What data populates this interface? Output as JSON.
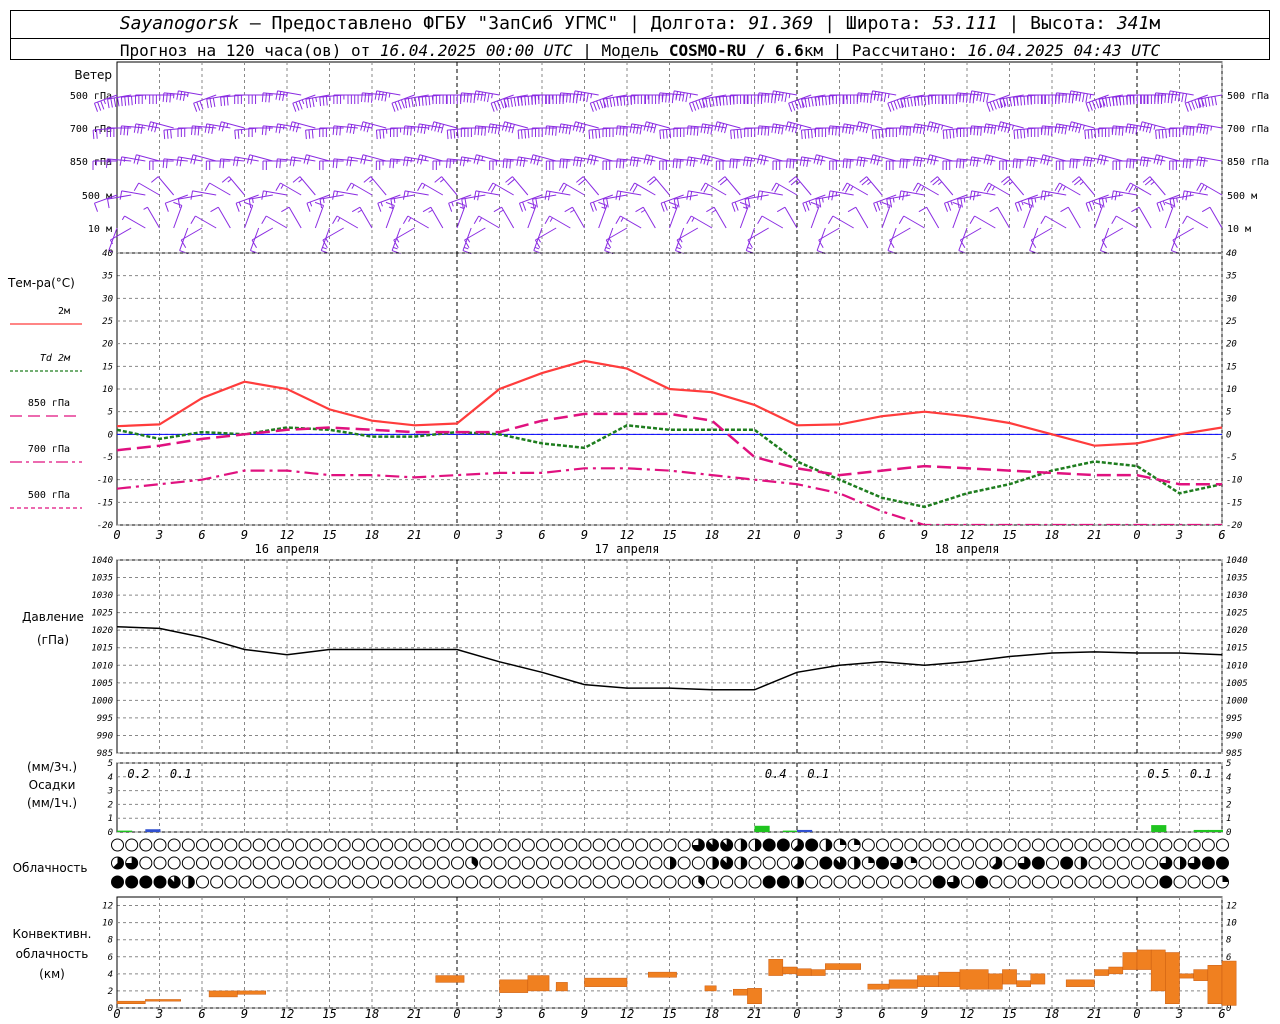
{
  "header": {
    "station": "Sayanogorsk",
    "provider": " — Предоставлено ФГБУ \"ЗапСиб УГМС\" | Долгота: ",
    "lon": "91.369",
    "lat_label": " | Широта: ",
    "lat": "53.111",
    "alt_label": " | Высота: ",
    "alt": "341",
    "alt_unit": "м",
    "forecast_pre": "Прогноз на 120 часа(ов) от ",
    "forecast_from": "16.04.2025 00:00 UTC",
    "model_pre": "  | Модель ",
    "model": "COSMO-RU / 6.6",
    "model_unit": "км",
    "calc_pre": " | Рассчитано: ",
    "calc_at": "16.04.2025 04:43 UTC"
  },
  "colors": {
    "wind": "#8a2be2",
    "t2m": "#ff3c3c",
    "td2m": "#1e7d1e",
    "t850": "#e0117f",
    "t700": "#e0117f",
    "t500": "#e0117f",
    "pressure": "#000000",
    "precip3": "#1fc41f",
    "precip1": "#3050d0",
    "conv": "#f08020",
    "zero_line": "#0000ff"
  },
  "labels": {
    "wind_title": "Ветер",
    "wind_levels": [
      "500 гПа",
      "700 гПа",
      "850 гПа",
      "500  м",
      "10   м"
    ],
    "temp_title": "Тем-ра(°С)",
    "temp_legend": [
      "2м",
      "Td  2м",
      "850 гПа",
      "700 гПа",
      "500 гПа"
    ],
    "pressure_title": "Давление",
    "pressure_unit": "(гПа)",
    "precip_units_top": "(мм/3ч.)",
    "precip_title": "Осадки",
    "precip_units_bottom": "(мм/1ч.)",
    "cloud_title": "Облачность",
    "conv_title_1": "Конвективн.",
    "conv_title_2": "облачность",
    "conv_unit": "(км)",
    "day_labels": [
      "16 апреля",
      "17 апреля",
      "18 апреля"
    ],
    "hour_ticks": [
      "0",
      "3",
      "6",
      "9",
      "12",
      "15",
      "18",
      "21",
      "0",
      "3",
      "6",
      "9",
      "12",
      "15",
      "18",
      "21",
      "0",
      "3",
      "6",
      "9",
      "12",
      "15",
      "18",
      "21",
      "0",
      "3",
      "6"
    ]
  },
  "chart_data": [
    {
      "type": "line",
      "title": "Тем-ра(°С)",
      "x_hours": [
        0,
        3,
        6,
        9,
        12,
        15,
        18,
        21,
        24,
        27,
        30,
        33,
        36,
        39,
        42,
        45,
        48,
        51,
        54,
        57,
        60,
        63,
        66,
        69,
        72,
        75,
        78
      ],
      "ylim": [
        -20,
        40
      ],
      "series": [
        {
          "name": "2м",
          "values": [
            1.8,
            2.2,
            8,
            11.6,
            10,
            5.5,
            3,
            2,
            2.4,
            10,
            13.5,
            16.2,
            14.5,
            10,
            9.3,
            6.5,
            2,
            2.2,
            4,
            5,
            4,
            2.5,
            0,
            -2.5,
            -2,
            0,
            1.5
          ]
        },
        {
          "name": "Td  2м",
          "values": [
            1,
            -1,
            0.5,
            0,
            1.5,
            1,
            -0.5,
            -0.5,
            0.5,
            0,
            -2,
            -3,
            2,
            1,
            1,
            1,
            -6,
            -10,
            -14,
            -16,
            -13,
            -11,
            -8,
            -6,
            -7,
            -13,
            -11
          ]
        },
        {
          "name": "850 гПа",
          "values": [
            -3.5,
            -2.5,
            -1,
            0,
            1,
            1.5,
            1,
            0.5,
            0.5,
            0.5,
            3,
            4.5,
            4.5,
            4.5,
            3,
            -5,
            -7.5,
            -9,
            -8,
            -7,
            -7.5,
            -8,
            -8.5,
            -9,
            -9,
            -11,
            -11
          ]
        },
        {
          "name": "700 гПа",
          "values": [
            -12,
            -11,
            -10,
            -8,
            -8,
            -9,
            -9,
            -9.5,
            -9,
            -8.5,
            -8.5,
            -7.5,
            -7.5,
            -8,
            -9,
            -10,
            -11,
            -13,
            -17,
            -20,
            -21,
            -22,
            -22,
            -23,
            -23,
            -23,
            -23
          ]
        }
      ]
    },
    {
      "type": "line",
      "title": "Давление",
      "x_hours": [
        0,
        3,
        6,
        9,
        12,
        15,
        18,
        21,
        24,
        27,
        30,
        33,
        36,
        39,
        42,
        45,
        48,
        51,
        54,
        57,
        60,
        63,
        66,
        69,
        72,
        75,
        78
      ],
      "ylim": [
        985,
        1040
      ],
      "values": [
        1021,
        1020.5,
        1018,
        1014.5,
        1013,
        1014.5,
        1014.5,
        1014.5,
        1014.5,
        1011,
        1008,
        1004.5,
        1003.5,
        1003.5,
        1003,
        1003,
        1008,
        1010,
        1011,
        1010,
        1011,
        1012.5,
        1013.5,
        1013.8,
        1013.5,
        1013.5,
        1013
      ]
    },
    {
      "type": "bar",
      "title": "Осадки",
      "ylim": [
        0,
        5
      ],
      "labels_3h": [
        {
          "hour": 1.5,
          "value": "0.2"
        },
        {
          "hour": 4.5,
          "value": "0.1"
        },
        {
          "hour": 46.5,
          "value": "0.4"
        },
        {
          "hour": 49.5,
          "value": "0.1"
        },
        {
          "hour": 73.5,
          "value": "0.5"
        },
        {
          "hour": 76.5,
          "value": "0.1"
        }
      ],
      "bars_1h": [
        {
          "hour": 0,
          "value": 0.1,
          "kind": "p3"
        },
        {
          "hour": 2,
          "value": 0.2,
          "kind": "p1"
        },
        {
          "hour": 45,
          "value": 0.45,
          "kind": "p3"
        },
        {
          "hour": 47,
          "value": 0.1,
          "kind": "p3"
        },
        {
          "hour": 48,
          "value": 0.15,
          "kind": "p1"
        },
        {
          "hour": 73,
          "value": 0.5,
          "kind": "p3"
        },
        {
          "hour": 76,
          "value": 0.15,
          "kind": "p3"
        },
        {
          "hour": 77,
          "value": 0.15,
          "kind": "p3"
        }
      ]
    },
    {
      "type": "heatmap",
      "title": "Облачность",
      "note": "octas per hour for three layers (0-8)",
      "rows": [
        [
          0,
          0,
          0,
          0,
          0,
          0,
          0,
          0,
          0,
          0,
          0,
          0,
          0,
          0,
          0,
          0,
          0,
          0,
          0,
          0,
          0,
          0,
          0,
          0,
          0,
          0,
          0,
          0,
          0,
          0,
          0,
          0,
          0,
          0,
          0,
          0,
          0,
          0,
          0,
          0,
          0,
          6,
          7,
          7,
          4,
          4,
          8,
          8,
          5,
          8,
          4,
          2,
          2,
          0,
          0,
          0,
          0,
          0,
          0,
          0,
          0,
          0,
          0,
          0,
          0,
          0,
          0,
          0,
          0,
          0,
          0,
          0,
          0,
          0,
          0,
          0,
          0,
          0,
          0
        ],
        [
          5,
          6,
          0,
          0,
          0,
          0,
          0,
          0,
          0,
          0,
          0,
          0,
          0,
          0,
          0,
          0,
          0,
          0,
          0,
          0,
          0,
          0,
          0,
          0,
          0,
          3,
          0,
          0,
          0,
          0,
          0,
          0,
          0,
          0,
          0,
          0,
          0,
          0,
          0,
          4,
          0,
          0,
          4,
          7,
          4,
          0,
          0,
          0,
          5,
          0,
          8,
          7,
          4,
          2,
          8,
          6,
          2,
          0,
          0,
          0,
          0,
          0,
          5,
          0,
          6,
          8,
          0,
          8,
          4,
          0,
          0,
          0,
          0,
          0,
          6,
          4,
          6,
          8,
          8
        ],
        [
          8,
          8,
          8,
          8,
          7,
          4,
          0,
          0,
          0,
          0,
          0,
          0,
          0,
          0,
          0,
          0,
          0,
          0,
          0,
          0,
          0,
          0,
          0,
          0,
          0,
          0,
          0,
          0,
          0,
          0,
          0,
          0,
          0,
          0,
          0,
          0,
          0,
          0,
          0,
          0,
          0,
          3,
          0,
          0,
          0,
          0,
          8,
          8,
          4,
          0,
          0,
          0,
          0,
          0,
          0,
          0,
          0,
          0,
          8,
          6,
          0,
          8,
          0,
          0,
          0,
          0,
          0,
          0,
          0,
          0,
          0,
          0,
          0,
          0,
          8,
          0,
          0,
          0,
          2
        ]
      ]
    },
    {
      "type": "bar",
      "title": "Конвективн. облачность",
      "ylim": [
        0,
        13
      ],
      "segments": [
        {
          "x0": 0,
          "x1": 2,
          "bottom": 0.5,
          "top": 0.8
        },
        {
          "x0": 2,
          "x1": 4.5,
          "bottom": 0.8,
          "top": 1.0
        },
        {
          "x0": 6.5,
          "x1": 8.5,
          "bottom": 1.3,
          "top": 2.0
        },
        {
          "x0": 8.5,
          "x1": 10.5,
          "bottom": 1.6,
          "top": 2.0
        },
        {
          "x0": 22.5,
          "x1": 24.5,
          "bottom": 3.0,
          "top": 3.8
        },
        {
          "x0": 27,
          "x1": 29,
          "bottom": 1.8,
          "top": 3.3
        },
        {
          "x0": 29,
          "x1": 30.5,
          "bottom": 2.0,
          "top": 3.8
        },
        {
          "x0": 31,
          "x1": 31.8,
          "bottom": 2.0,
          "top": 3.0
        },
        {
          "x0": 33,
          "x1": 36,
          "bottom": 2.5,
          "top": 3.5
        },
        {
          "x0": 37.5,
          "x1": 39.5,
          "bottom": 3.6,
          "top": 4.2
        },
        {
          "x0": 41.5,
          "x1": 42.3,
          "bottom": 2.0,
          "top": 2.6
        },
        {
          "x0": 43.5,
          "x1": 44.5,
          "bottom": 1.5,
          "top": 2.2
        },
        {
          "x0": 44.5,
          "x1": 45.5,
          "bottom": 0.5,
          "top": 2.3
        },
        {
          "x0": 46,
          "x1": 47,
          "bottom": 3.8,
          "top": 5.7
        },
        {
          "x0": 47,
          "x1": 48,
          "bottom": 4.0,
          "top": 4.8
        },
        {
          "x0": 48,
          "x1": 49,
          "bottom": 3.8,
          "top": 4.6
        },
        {
          "x0": 49,
          "x1": 50,
          "bottom": 3.8,
          "top": 4.5
        },
        {
          "x0": 50,
          "x1": 52.5,
          "bottom": 4.5,
          "top": 5.2
        },
        {
          "x0": 53,
          "x1": 54.5,
          "bottom": 2.2,
          "top": 2.8
        },
        {
          "x0": 54.5,
          "x1": 56.5,
          "bottom": 2.3,
          "top": 3.3
        },
        {
          "x0": 56.5,
          "x1": 58,
          "bottom": 2.5,
          "top": 3.8
        },
        {
          "x0": 58,
          "x1": 59.5,
          "bottom": 2.5,
          "top": 4.2
        },
        {
          "x0": 59.5,
          "x1": 61.5,
          "bottom": 2.2,
          "top": 4.5
        },
        {
          "x0": 61.5,
          "x1": 62.5,
          "bottom": 2.2,
          "top": 4.0
        },
        {
          "x0": 62.5,
          "x1": 63.5,
          "bottom": 2.8,
          "top": 4.5
        },
        {
          "x0": 63.5,
          "x1": 64.5,
          "bottom": 2.5,
          "top": 3.2
        },
        {
          "x0": 64.5,
          "x1": 65.5,
          "bottom": 2.8,
          "top": 4.0
        },
        {
          "x0": 67,
          "x1": 69,
          "bottom": 2.5,
          "top": 3.3
        },
        {
          "x0": 69,
          "x1": 70,
          "bottom": 3.8,
          "top": 4.5
        },
        {
          "x0": 70,
          "x1": 71,
          "bottom": 4.0,
          "top": 4.8
        },
        {
          "x0": 71,
          "x1": 72,
          "bottom": 4.5,
          "top": 6.5
        },
        {
          "x0": 72,
          "x1": 73,
          "bottom": 4.5,
          "top": 6.8
        },
        {
          "x0": 73,
          "x1": 74,
          "bottom": 2.0,
          "top": 6.8
        },
        {
          "x0": 74,
          "x1": 75,
          "bottom": 0.5,
          "top": 6.5
        },
        {
          "x0": 75,
          "x1": 76,
          "bottom": 3.5,
          "top": 4.0
        },
        {
          "x0": 76,
          "x1": 77,
          "bottom": 3.2,
          "top": 4.5
        },
        {
          "x0": 77,
          "x1": 78,
          "bottom": 0.5,
          "top": 5.0
        },
        {
          "x0": 78,
          "x1": 79,
          "bottom": 0.3,
          "top": 5.5
        }
      ]
    }
  ],
  "wind_rows_kts": [
    [
      35,
      40,
      40,
      35,
      35,
      35,
      35,
      30,
      30,
      30,
      30,
      30,
      30,
      35,
      35,
      35,
      35,
      35,
      40,
      40,
      45,
      45,
      45,
      45,
      50,
      50,
      50,
      55,
      55,
      60,
      65,
      65,
      60,
      60,
      55,
      55,
      55,
      55,
      55,
      55,
      55,
      55,
      55,
      60,
      60,
      60,
      60,
      60,
      55,
      55,
      55,
      55,
      55,
      55,
      55,
      55,
      55,
      55,
      55,
      55,
      55,
      60,
      60,
      60,
      60,
      60,
      60,
      60,
      65,
      65,
      65,
      70,
      70,
      70,
      70,
      60,
      60,
      60,
      60
    ],
    [
      25,
      30,
      30,
      30,
      30,
      30,
      30,
      30,
      30,
      25,
      25,
      25,
      25,
      25,
      30,
      30,
      30,
      30,
      30,
      35,
      35,
      35,
      35,
      35,
      40,
      40,
      40,
      40,
      40,
      40,
      40,
      40,
      40,
      40,
      40,
      40,
      40,
      40,
      40,
      40,
      40,
      40,
      40,
      40,
      40,
      40,
      40,
      40,
      40,
      45,
      45,
      45,
      45,
      45,
      45,
      45,
      45,
      45,
      45,
      45,
      45,
      45,
      45,
      45,
      45,
      45,
      45,
      45,
      45,
      45,
      45,
      45,
      45,
      45,
      45,
      45,
      45,
      45,
      45
    ],
    [
      15,
      15,
      15,
      20,
      20,
      20,
      20,
      20,
      20,
      20,
      20,
      20,
      20,
      20,
      20,
      20,
      20,
      20,
      20,
      20,
      25,
      25,
      25,
      25,
      25,
      25,
      25,
      25,
      25,
      30,
      30,
      30,
      30,
      30,
      30,
      30,
      30,
      30,
      30,
      30,
      30,
      30,
      30,
      30,
      30,
      30,
      30,
      30,
      30,
      30,
      30,
      30,
      30,
      30,
      30,
      30,
      30,
      30,
      30,
      30,
      30,
      30,
      30,
      30,
      30,
      30,
      30,
      30,
      30,
      30,
      30,
      30,
      30,
      30,
      30,
      30,
      30,
      30,
      30
    ],
    [
      10,
      10,
      10,
      10,
      10,
      10,
      10,
      10,
      10,
      15,
      15,
      15,
      15,
      15,
      15,
      15,
      15,
      15,
      15,
      15,
      15,
      15,
      15,
      15,
      15,
      15,
      20,
      20,
      20,
      20,
      20,
      20,
      20,
      20,
      20,
      20,
      20,
      20,
      20,
      20,
      20,
      20,
      20,
      20,
      20,
      20,
      20,
      20,
      20,
      25,
      25,
      25,
      25,
      25,
      25,
      25,
      25,
      25,
      25,
      25,
      25,
      25,
      25,
      25,
      25,
      25,
      25,
      25,
      25,
      25,
      25,
      25,
      25,
      25,
      25,
      25,
      25,
      25,
      25
    ],
    [
      5,
      5,
      5,
      5,
      10,
      10,
      10,
      10,
      10,
      10,
      10,
      10,
      10,
      10,
      10,
      15,
      15,
      15,
      15,
      15,
      15,
      15,
      15,
      15,
      15,
      15,
      15,
      15,
      15,
      15,
      15,
      15,
      15,
      15,
      15,
      15,
      15,
      15,
      15,
      15,
      15,
      15,
      15,
      15,
      15,
      15,
      10,
      10,
      10,
      10,
      10,
      10,
      10,
      10,
      10,
      10,
      10,
      10,
      10,
      10,
      10,
      10,
      10,
      10,
      10,
      10,
      10,
      10,
      10,
      10,
      10,
      10,
      10,
      10,
      10,
      10,
      10,
      10,
      10
    ]
  ]
}
